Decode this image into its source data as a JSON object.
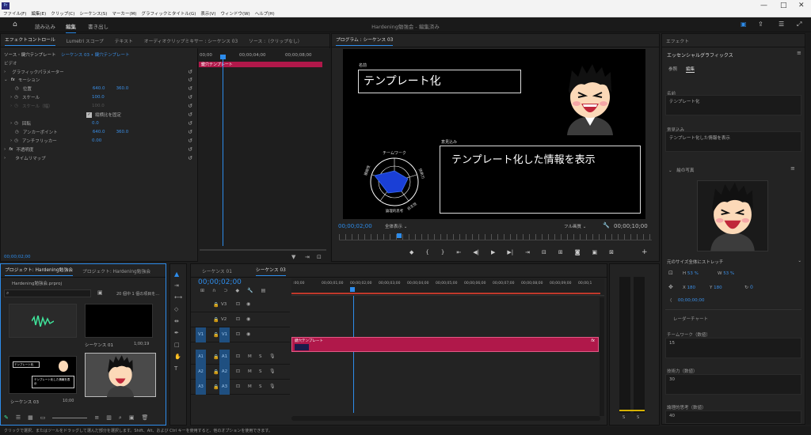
{
  "app": {
    "logo": "Pr",
    "title": "Hardening勉強会 - 編集済み"
  },
  "menu": [
    "ファイル(F)",
    "編集(E)",
    "クリップ(C)",
    "シーケンス(S)",
    "マーカー(M)",
    "グラフィックとタイトル(G)",
    "表示(V)",
    "ウィンドウ(W)",
    "ヘルプ(H)"
  ],
  "workspaces": {
    "import": "読み込み",
    "edit": "編集",
    "export": "書き出し"
  },
  "effect_controls": {
    "tabs": [
      "エフェクトコントロール",
      "Lumetri スコープ",
      "テキスト",
      "オーディオクリップミキサー : シーケンス 03",
      "ソース :（クリップなし）"
    ],
    "source_label": "ソース・鍵穴テンプレート",
    "seq_label": "シーケンス 03 • 鍵穴テンプレート",
    "timecodes": [
      "00;00",
      "00;00;04;00",
      "00;00;08;00"
    ],
    "clip_name": "鍵穴テンプレート",
    "section_video": "ビデオ",
    "rows": {
      "graphic": "グラフィックパラメーター",
      "motion": "モーション",
      "position": "位置",
      "position_x": "640.0",
      "position_y": "360.0",
      "scale": "スケール",
      "scale_val": "100.0",
      "scale_w": "スケール（幅）",
      "scale_w_val": "100.0",
      "uniform": "縦横比を固定",
      "rotation": "回転",
      "rotation_val": "0.0",
      "anchor": "アンカーポイント",
      "anchor_x": "640.0",
      "anchor_y": "360.0",
      "flicker": "アンチフリッカー",
      "flicker_val": "0.00",
      "opacity": "不透明度",
      "remap": "タイムリマップ"
    },
    "footer_tc": "00;00;02;00"
  },
  "program": {
    "title": "プログラム : シーケンス 03",
    "timecode": "00;00;02;00",
    "fit": "全体表示",
    "quality": "フル画質",
    "duration": "00;00;10;00",
    "title_caption": "名前",
    "title_text": "テンプレート化",
    "box_caption": "意見込み",
    "box_text": "テンプレート化した情報を表示",
    "radar_labels": [
      "チームワーク",
      "技術力",
      "自主性",
      "論理的思考",
      "積極性"
    ],
    "transport": [
      "⇤",
      "{",
      "}",
      "⇥",
      "◀|",
      "◀",
      "▶",
      "▶|",
      "⇥|"
    ]
  },
  "project": {
    "tabs": [
      "プロジェクト: Hardening勉強会",
      "プロジェクト: Hardening勉強会"
    ],
    "file": "Hardening勉強会.prproj",
    "count": "20 個中 1 個の項目を…",
    "items": [
      {
        "name": "",
        "dur": ""
      },
      {
        "name": "シーケンス 01",
        "dur": "1;00;19"
      },
      {
        "name": "シーケンス 03",
        "dur": "10;00"
      },
      {
        "name": "",
        "dur": ""
      }
    ],
    "thumb_caption_title": "テンプレート化",
    "thumb_caption_box": "テンプレート化した情報を表示"
  },
  "timeline": {
    "tabs": [
      "シーケンス 01",
      "シーケンス 03"
    ],
    "timecode": "00;00;02;00",
    "ruler": [
      ":00;00",
      "00;00;01;00",
      "00;00;02;00",
      "00;00;03;00",
      "00;00;04;00",
      "00;00;05;00",
      "00;00;06;00",
      "00;00;07;00",
      "00;00;08;00",
      "00;00;09;00",
      "00;00;1"
    ],
    "tracks": [
      "V3",
      "V2",
      "V1",
      "A1",
      "A2",
      "A3"
    ],
    "src_video": "V1",
    "src_audio": [
      "A1",
      "A2",
      "A3"
    ],
    "mute": "M",
    "solo": "S",
    "clip_label": "鍵穴テンプレート",
    "meter": [
      "S",
      "S"
    ]
  },
  "essential": {
    "panel": "エフェクト",
    "title": "エッセンシャルグラフィックス",
    "tabs": [
      "参照",
      "編集"
    ],
    "name_label": "名前",
    "name_value": "テンプレート化",
    "note_label": "意見込み",
    "note_value": "テンプレート化した情報を表示",
    "image_section": "絵の写真",
    "stretch": "元のサイズ全体にストレッチ",
    "h_scale": "53 %",
    "w_scale": "53 %",
    "pos_x": "180",
    "pos_y": "180",
    "rot": "0",
    "tc": "00;00;00;00",
    "radar": "レーダーチャート",
    "fields": [
      {
        "label": "チームワーク（数値）",
        "value": "15"
      },
      {
        "label": "技術力（数値）",
        "value": "30"
      },
      {
        "label": "論理的思考（数値）",
        "value": "40"
      }
    ]
  },
  "statusbar": "クリックで選択、またはツールをドラッグして選んだ部分を選択します。Shift、Alt、および Ctrl キーを使用すると、他のオプションを使用できます。",
  "colors": {
    "accent": "#2d8ceb",
    "clip": "#b0184a",
    "track_toggle": "#1f4f80"
  }
}
